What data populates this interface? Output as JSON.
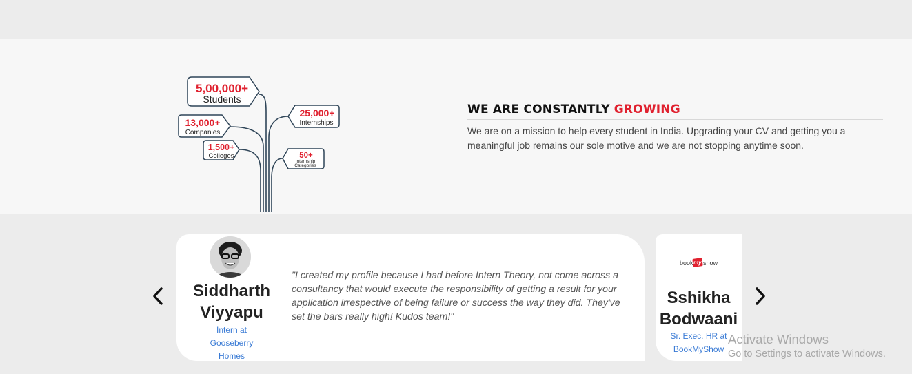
{
  "growth": {
    "tags": [
      {
        "value": "5,00,000+",
        "label": "Students"
      },
      {
        "value": "13,000+",
        "label": "Companies"
      },
      {
        "value": "1,500+",
        "label": "Colleges"
      },
      {
        "value": "25,000+",
        "label": "Internships"
      },
      {
        "value": "50+",
        "label_lines": [
          "Internship",
          "Categories"
        ]
      }
    ],
    "heading_prefix": "WE ARE CONSTANTLY ",
    "heading_accent": "GROWING",
    "description": "We are on a mission to help every student in India. Upgrading your CV and getting you a meaningful job remains our sole motive and we are not stopping anytime soon."
  },
  "testimonials": {
    "items": [
      {
        "name_line1": "Siddharth",
        "name_line2": "Viyyapu",
        "role_lines": [
          "Intern at",
          "Gooseberry",
          "Homes"
        ],
        "quote": "\"I created my profile because I had before Intern Theory, not come across a consultancy that would execute the responsibility of getting a result for your application irrespective of being failure or success the way they did. They've set the bars really high! Kudos team!\""
      },
      {
        "logo_parts": [
          "book",
          "my",
          "show"
        ],
        "name_line1": "Sshikha",
        "name_line2": "Bodwaani",
        "role_lines": [
          "Sr. Exec. HR at",
          "BookMyShow"
        ]
      }
    ],
    "prev_icon": "chevron-left-icon",
    "next_icon": "chevron-right-icon"
  },
  "watermark": {
    "title": "Activate Windows",
    "subtitle": "Go to Settings to activate Windows."
  },
  "colors": {
    "accent": "#e0212f",
    "tag_border": "#2f4558",
    "link": "#3a7bd5"
  }
}
